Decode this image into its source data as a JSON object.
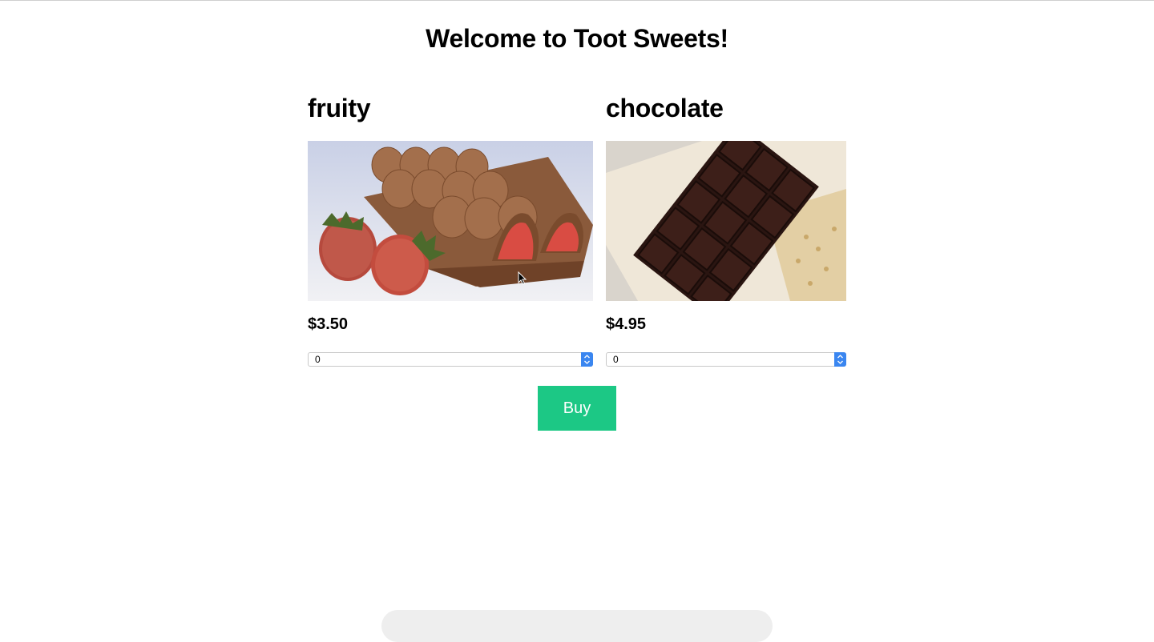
{
  "page": {
    "title": "Welcome to Toot Sweets!"
  },
  "products": [
    {
      "name": "fruity",
      "image": "strawberry-chocolate-bar",
      "price": "$3.50",
      "quantity": "0"
    },
    {
      "name": "chocolate",
      "image": "dark-chocolate-bar",
      "price": "$4.95",
      "quantity": "0"
    }
  ],
  "actions": {
    "buy_label": "Buy"
  },
  "colors": {
    "buy_button": "#1cc885",
    "select_arrow": "#3a86f0"
  }
}
